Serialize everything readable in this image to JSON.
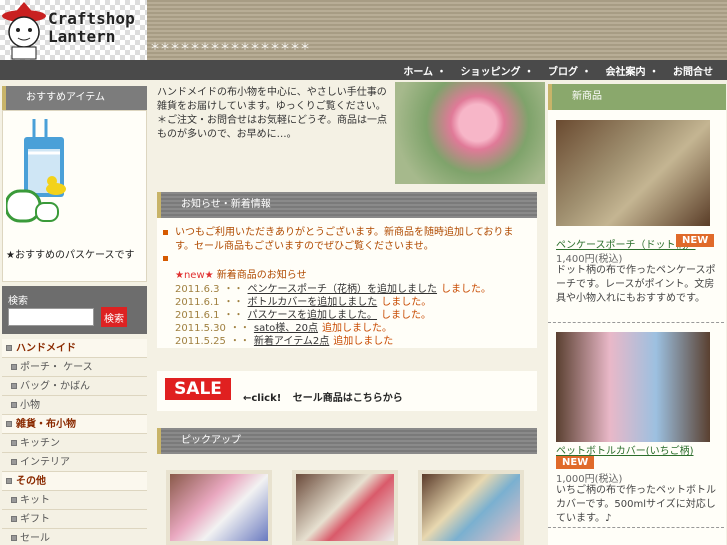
{
  "header": {
    "logo_line1": "Craftshop",
    "logo_line2": "Lantern",
    "tagline": "＊＊＊＊＊＊＊＊＊＊＊＊＊＊＊＊"
  },
  "nav": [
    "ホーム ・",
    "ショッピング ・",
    "ブログ ・",
    "会社案内 ・",
    "お問合せ"
  ],
  "sidebar": {
    "featured_title": "おすすめアイテム",
    "featured_caption": "★おすすめのパスケースです",
    "search_label": "検索",
    "search_placeholder": "",
    "search_button": "検索",
    "categories": [
      {
        "label": "ハンドメイド",
        "type": "main"
      },
      {
        "label": "ポーチ・ ケース",
        "type": "sub"
      },
      {
        "label": "バッグ・かばん",
        "type": "sub"
      },
      {
        "label": "小物",
        "type": "sub"
      },
      {
        "label": "雑貨・布小物",
        "type": "main"
      },
      {
        "label": "キッチン",
        "type": "sub"
      },
      {
        "label": "インテリア",
        "type": "sub"
      },
      {
        "label": "その他",
        "type": "main"
      },
      {
        "label": "キット",
        "type": "sub"
      },
      {
        "label": "ギフト",
        "type": "sub"
      },
      {
        "label": "セール",
        "type": "sub"
      }
    ]
  },
  "intro": {
    "p1": "ハンドメイドの布小物を中心に、やさしい手仕事の雑貨をお届けしています。ゆっくりご覧ください。",
    "p2": "＊ご注文・お問合せはお気軽にどうぞ。商品は一点ものが多いので、お早めに…。"
  },
  "news": {
    "title": "お知らせ・新着情報",
    "main": "いつもご利用いただきありがとうございます。新商品を随時追加しております。セール商品もございますのでぜひご覧くださいませ。",
    "new_label": "★new★",
    "new_title": "新着商品のお知らせ",
    "rows": [
      {
        "date": "2011.6.3",
        "mid": "・・",
        "link": "ペンケースポーチ（花柄）を追加しました",
        "tail": "しました。"
      },
      {
        "date": "2011.6.1",
        "mid": "・・",
        "link": "ボトルカバーを追加しました",
        "tail": "しました。"
      },
      {
        "date": "2011.6.1",
        "mid": "・・",
        "link": "パスケースを追加しました。",
        "tail": "しました。"
      },
      {
        "date": "2011.5.30",
        "mid": "・・",
        "link": "sato様、20点",
        "tail": "追加しました。"
      },
      {
        "date": "2011.5.25",
        "mid": "・・",
        "link": "新着アイテム2点",
        "tail": "追加しました"
      }
    ]
  },
  "sale": {
    "badge": "SALE",
    "click": "←click!",
    "text": "セール商品はこちらから"
  },
  "pickup": {
    "title": "ピックアップ"
  },
  "recommend": {
    "title": "新商品",
    "items": [
      {
        "name": "ペンケースポーチ（ドット柄）",
        "badge": "NEW",
        "price": "1,400円(税込)",
        "desc": "ドット柄の布で作ったペンケースポーチです。レースがポイント。文房具や小物入れにもおすすめです。"
      },
      {
        "name": "ペットボトルカバー(いちご柄)",
        "badge": "NEW",
        "price": "1,000円(税込)",
        "desc": "いちご柄の布で作ったペットボトルカバーです。500mlサイズに対応しています。♪"
      }
    ]
  }
}
